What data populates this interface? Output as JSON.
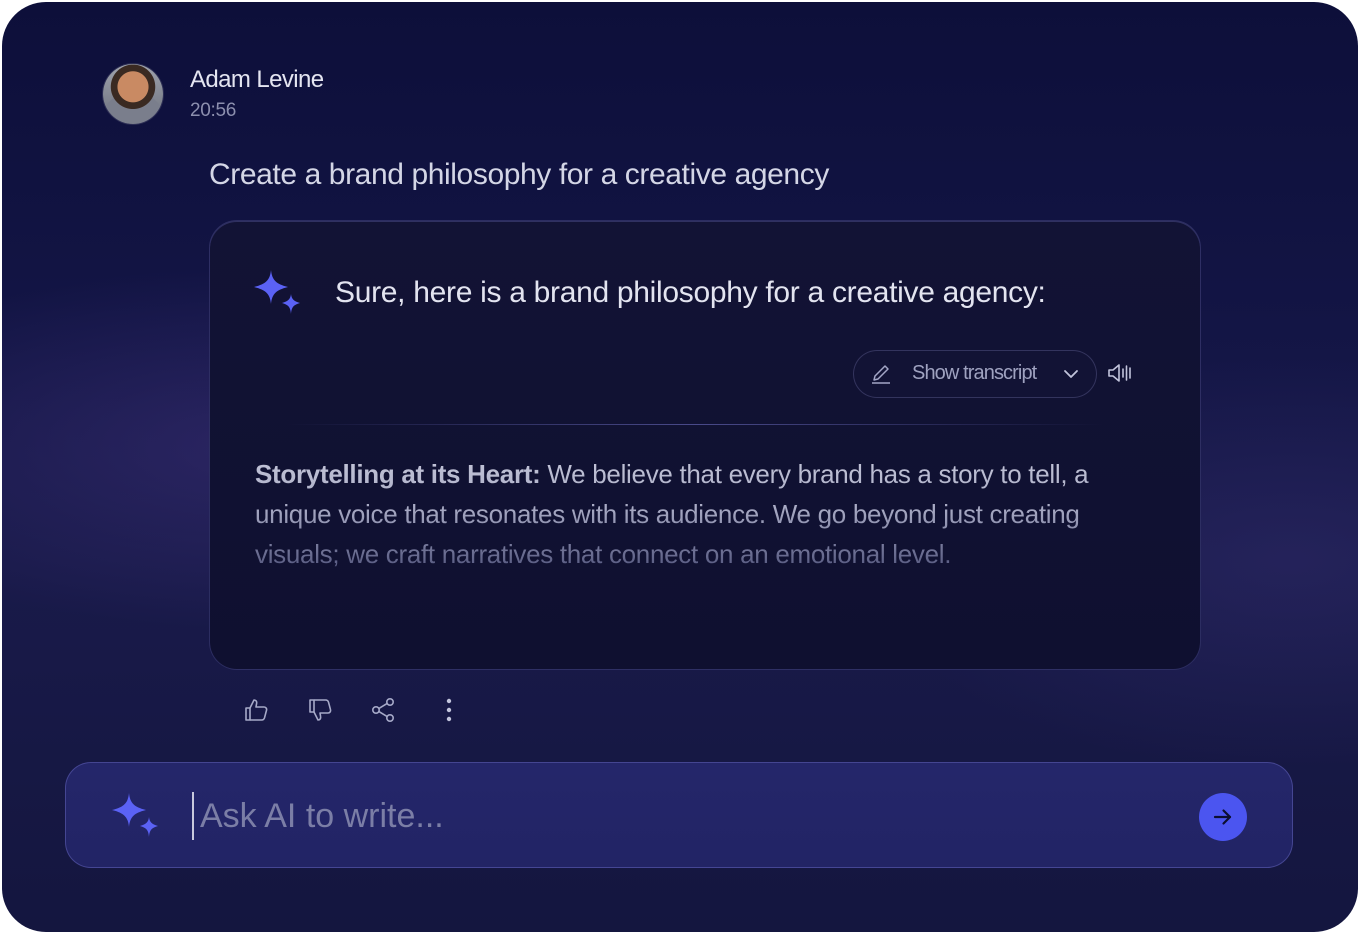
{
  "user": {
    "name": "Adam Levine",
    "time": "20:56"
  },
  "prompt": "Create a brand philosophy for a creative agency",
  "response": {
    "intro": "Sure, here is a brand philosophy for a creative agency:",
    "transcript_label": "Show transcript",
    "heading": "Storytelling at its Heart:",
    "body": " We believe that every brand has a story to tell, a unique voice that resonates with its audience. We go beyond just creating visuals; we craft narratives that connect on an emotional level."
  },
  "actions": [
    "thumbs-up-icon",
    "thumbs-down-icon",
    "share-icon",
    "more-vertical-icon"
  ],
  "composer": {
    "placeholder": "Ask AI to write...",
    "value": ""
  },
  "colors": {
    "accent": "#4b55f0",
    "spark": "#5b62f5",
    "background": "#131545"
  }
}
